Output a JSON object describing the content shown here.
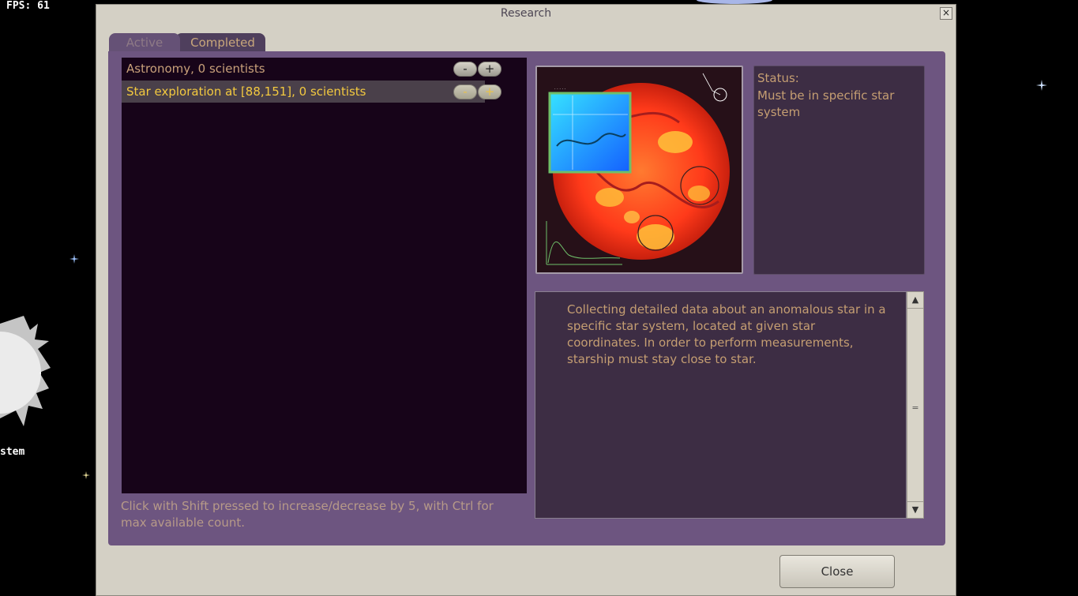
{
  "hud": {
    "fps_label": "FPS: 61",
    "system_label": "stem"
  },
  "window": {
    "title": "Research",
    "close_glyph": "×"
  },
  "tabs": [
    {
      "label": "Active"
    },
    {
      "label": "Completed"
    }
  ],
  "research_list": [
    {
      "label": "Astronomy, 0 scientists",
      "minus": "-",
      "plus": "+"
    },
    {
      "label": "Star exploration at [88,151], 0 scientists",
      "minus": "-",
      "plus": "+"
    }
  ],
  "hint": "Click with Shift pressed to increase/decrease by 5, with Ctrl for max available count.",
  "status": {
    "title": "Status:",
    "text": "Must be in specific star system"
  },
  "description": "Collecting detailed data about an anomalous star in a specific star system, located at given star coordinates. In order to perform measurements, starship must stay close to star.",
  "scrollbar": {
    "up": "▲",
    "down": "▼",
    "thumb": "="
  },
  "footer": {
    "close_label": "Close"
  },
  "image": {
    "name": "anomalous-star-image",
    "colors": {
      "star": "#ff3a1a",
      "hot": "#ffc23a",
      "cold": "#1fa7ff",
      "frame": "#6fbf6a"
    }
  }
}
